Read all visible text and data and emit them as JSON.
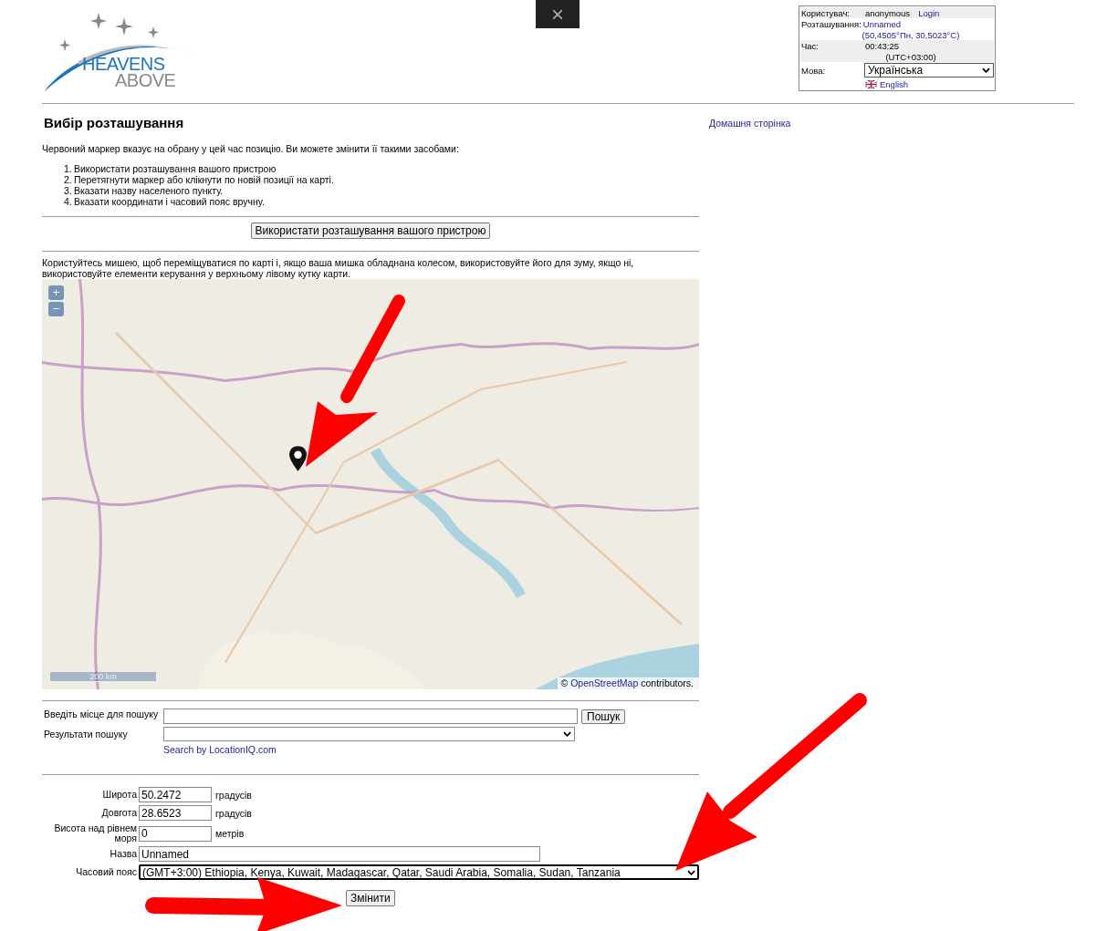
{
  "logo": {
    "line1": "HEAVENS",
    "line2": "ABOVE"
  },
  "close_button": "×",
  "user_panel": {
    "user_label": "Користувач:",
    "user_value": "anonymous",
    "login_link": "Login",
    "location_label": "Розташування:",
    "location_link": "Unnamed",
    "coords_link": "(50,4505°Пн, 30,5023°С)",
    "time_label": "Час:",
    "time_value": "00:43:25",
    "utc_offset": "(UTC+03:00)",
    "language_label": "Мова:",
    "language_value": "Українська",
    "english_link": "English"
  },
  "page_title": "Вибір розташування",
  "home_link": "Домашня сторінка",
  "intro": "Червоний маркер вказує на обрану у цей час позицію. Ви можете змінити її такими засобами:",
  "steps": [
    {
      "marker": "1.",
      "text": "Використати розташування вашого пристрою"
    },
    {
      "marker": "2.",
      "text": "Перетягнути маркер або клікнути по новій позиції на карті."
    },
    {
      "marker": "3.",
      "text": "Вказати назву населеного пункту."
    },
    {
      "marker": "4.",
      "text": "Вказати координати і часовий пояс вручну."
    }
  ],
  "device_button": "Використати розташування вашого пристрою",
  "map_hint": "Користуйтесь мишею, щоб переміщуватися по карті і, якщо ваша мишка обладнана колесом, використовуйте його для зуму, якщо ні, використовуйте елементи керування у верхньому лівому кутку карти.",
  "map": {
    "kind": "picture",
    "zoom_in": "+",
    "zoom_out": "−",
    "scale": "200 km",
    "attribution_prefix": "©",
    "attribution_link": "OpenStreetMap",
    "attribution_suffix": "contributors."
  },
  "search": {
    "label": "Введіть місце для пошуку",
    "button": "Пошук",
    "results_label": "Результати пошуку",
    "provider_link": "Search by LocationIQ.com"
  },
  "coords": [
    {
      "label": "Широта",
      "value": "50.2472",
      "unit": "градусів"
    },
    {
      "label": "Довгота",
      "value": "28.6523",
      "unit": "градусів"
    },
    {
      "label": "Висота над рівнем моря",
      "value": "0",
      "unit": "метрів"
    }
  ],
  "name": {
    "label": "Назва",
    "value": "Unnamed"
  },
  "timezone": {
    "label": "Часовий пояс",
    "value": "(GMT+3:00) Ethiopia, Kenya, Kuwait, Madagascar, Qatar, Saudi Arabia, Somalia, Sudan, Tanzania"
  },
  "submit_button": "Змінити"
}
